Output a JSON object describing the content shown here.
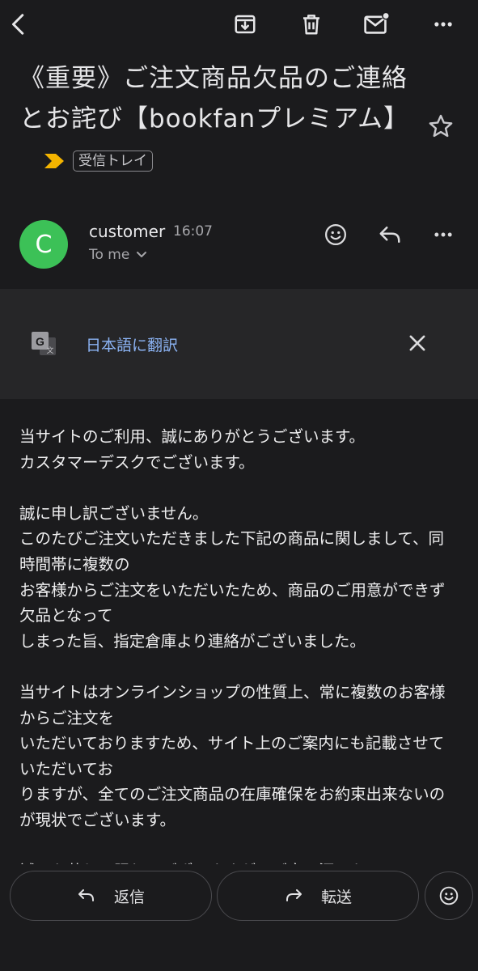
{
  "toolbar": {
    "back_icon": "back-arrow-icon",
    "archive_icon": "archive-icon",
    "delete_icon": "trash-icon",
    "mark_unread_icon": "mark-unread-icon",
    "more_icon": "more-horizontal-icon"
  },
  "subject": {
    "text": "《重要》ご注文商品欠品のご連絡とお詫び【bookfanプレミアム】",
    "label": "受信トレイ",
    "importance_icon": "importance-marker-icon",
    "star_icon": "star-outline-icon"
  },
  "sender": {
    "avatar_letter": "C",
    "avatar_color": "#3cc157",
    "name": "customer",
    "time": "16:07",
    "recipient": "To me"
  },
  "translate": {
    "link": "日本語に翻訳",
    "icon": "google-translate-icon"
  },
  "body": {
    "text": "当サイトのご利用、誠にありがとうございます。\nカスタマーデスクでございます。\n\n誠に申し訳ございません。\nこのたびご注文いただきました下記の商品に関しまして、同時間帯に複数の\nお客様からご注文をいただいたため、商品のご用意ができず欠品となって\nしまった旨、指定倉庫より連絡がございました。\n\n当サイトはオンラインショップの性質上、常に複数のお客様からご注文を\nいただいておりますため、サイト上のご案内にも記載させていただいてお\nりますが、全てのご注文商品の在庫確保をお約束出来ないのが現状でございます。\n\n誠に心苦しい限りでございますが、ご意に添いか"
  },
  "actions": {
    "reply_label": "返信",
    "forward_label": "転送"
  },
  "colors": {
    "background": "#1b1b1d",
    "translate_bar": "#262628",
    "link": "#8cb4f5",
    "importance": "#f4b400"
  }
}
